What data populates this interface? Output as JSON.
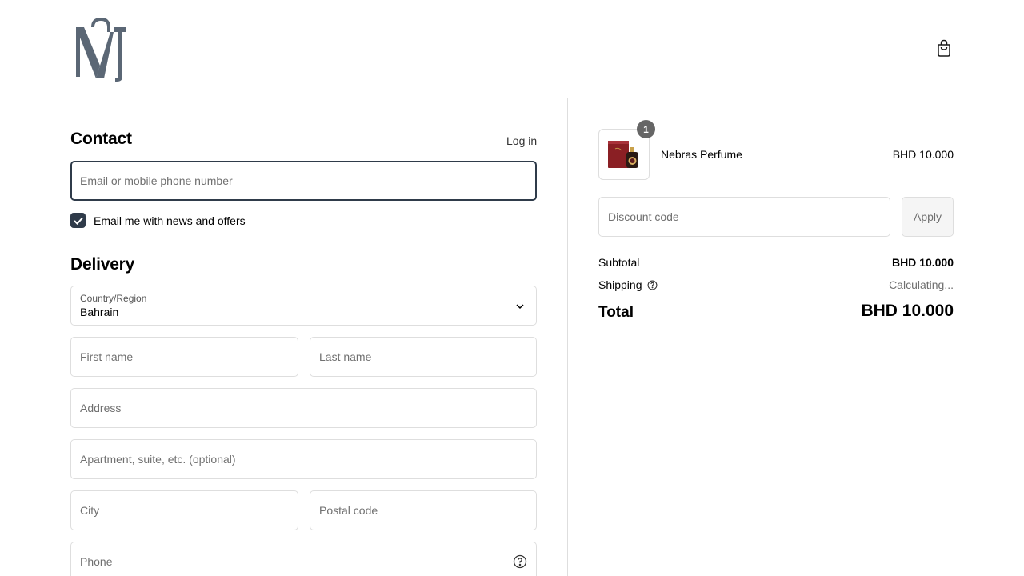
{
  "header": {
    "logo_icon": "mv-monogram-logo",
    "cart_icon": "shopping-bag-icon"
  },
  "contact": {
    "title": "Contact",
    "login_label": "Log in",
    "email_placeholder": "Email or mobile phone number",
    "newsletter_label": "Email me with news and offers",
    "newsletter_checked": true
  },
  "delivery": {
    "title": "Delivery",
    "country_label": "Country/Region",
    "country_value": "Bahrain",
    "first_name_placeholder": "First name",
    "last_name_placeholder": "Last name",
    "address_placeholder": "Address",
    "apartment_placeholder": "Apartment, suite, etc. (optional)",
    "city_placeholder": "City",
    "postal_placeholder": "Postal code",
    "phone_placeholder": "Phone"
  },
  "summary": {
    "product": {
      "name": "Nebras Perfume",
      "price": "BHD 10.000",
      "quantity": "1"
    },
    "discount_placeholder": "Discount code",
    "apply_label": "Apply",
    "subtotal_label": "Subtotal",
    "subtotal_value": "BHD 10.000",
    "shipping_label": "Shipping",
    "shipping_value": "Calculating...",
    "total_label": "Total",
    "total_value": "BHD 10.000"
  },
  "colors": {
    "accent": "#2f3b4a",
    "logo": "#5b6775",
    "border": "#dedede",
    "muted": "#707070"
  }
}
